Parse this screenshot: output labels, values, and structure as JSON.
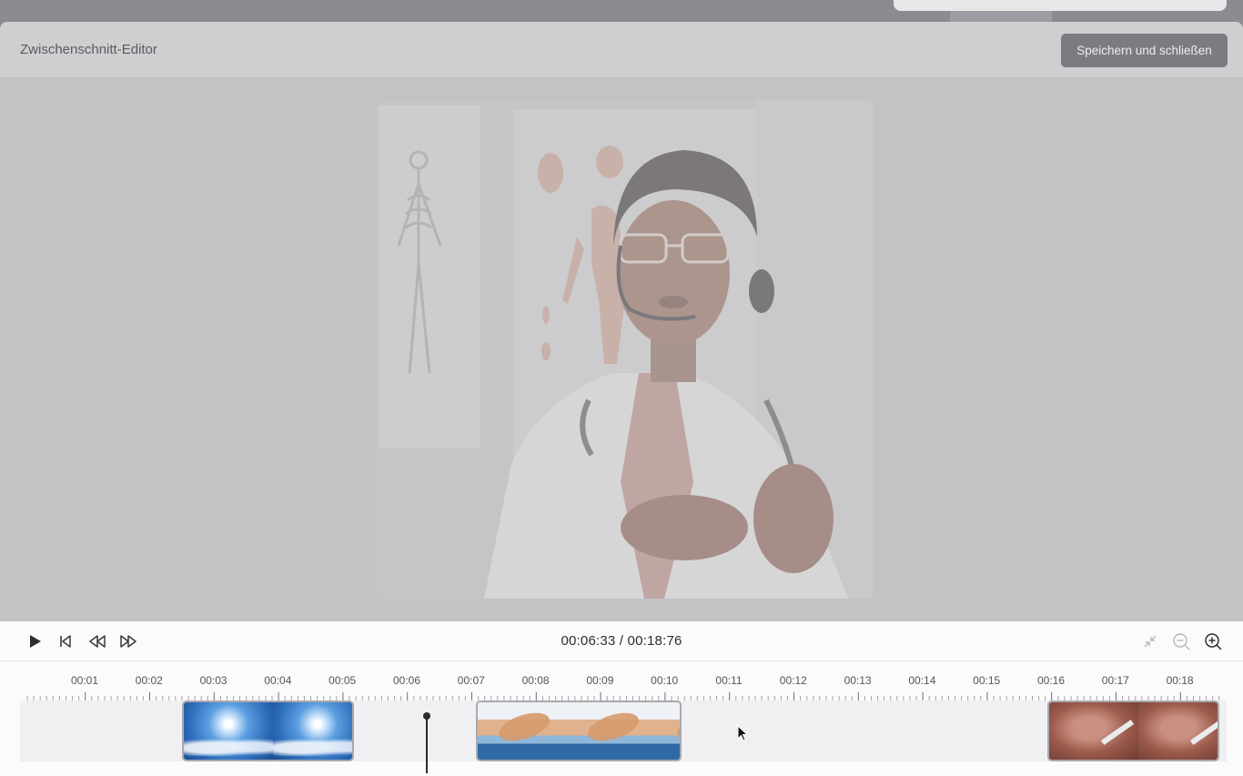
{
  "editor": {
    "title": "Zwischenschnitt-Editor",
    "save_button_label": "Speichern und schließen"
  },
  "player": {
    "current_time": "00:06:33",
    "total_time": "00:18:76",
    "timecode": "00:06:33 / 00:18:76"
  },
  "icons": {
    "play": "play-icon",
    "skip_start": "skip-to-start-icon",
    "rewind": "rewind-icon",
    "fast_forward": "fast-forward-icon",
    "collapse": "collapse-icon",
    "zoom_out": "zoom-out-icon",
    "zoom_in": "zoom-in-icon"
  },
  "timeline": {
    "labels": [
      "00:01",
      "00:02",
      "00:03",
      "00:04",
      "00:05",
      "00:06",
      "00:07",
      "00:08",
      "00:09",
      "00:10",
      "00:11",
      "00:12",
      "00:13",
      "00:14",
      "00:15",
      "00:16",
      "00:17",
      "00:18"
    ],
    "clips": [
      {
        "type": "sky"
      },
      {
        "type": "beach"
      },
      {
        "type": "skin"
      }
    ]
  },
  "colors": {
    "overlay": "#c5c5c8",
    "panel": "#fbfbfb",
    "save_button": "#7c7c80",
    "playhead": "#2b2b2e"
  }
}
